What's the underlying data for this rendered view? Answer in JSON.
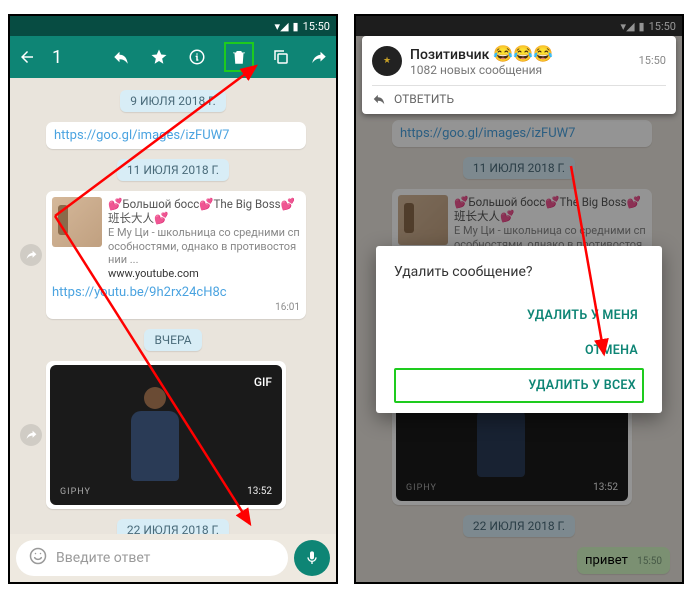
{
  "status": {
    "time": "15:50"
  },
  "select_header": {
    "count": "1"
  },
  "dates": {
    "d1": "9 ИЮЛЯ 2018 Г.",
    "d2": "11 ИЮЛЯ 2018 Г.",
    "d3": "ВЧЕРА",
    "d4": "22 ИЮЛЯ 2018 Г."
  },
  "msgs": {
    "link1": "https://goo.gl/images/izFUW7",
    "preview_title": "💕Большой босс💕The Big Boss💕班长大人💕",
    "preview_desc": "Е Му Ци - школьница со средними способностями, однако в противостоянии ...",
    "preview_site": "www.youtube.com",
    "link2": "https://youtu.be/9h2rx24cH8c",
    "link2_time": "16:01",
    "gif_label": "GIF",
    "gif_brand": "GIPHY",
    "gif_time": "13:52",
    "hello": "привет",
    "hello_time": "15:50"
  },
  "composer": {
    "placeholder": "Введите ответ"
  },
  "notif": {
    "title": "Позитивчик",
    "emoji": "😂😂😂",
    "sub": "1082 новых сообщения",
    "time": "15:50",
    "reply": "ОТВЕТИТЬ"
  },
  "dialog": {
    "title": "Удалить сообщение?",
    "opt1": "УДАЛИТЬ У МЕНЯ",
    "opt2": "ОТМЕНА",
    "opt3": "УДАЛИТЬ У ВСЕХ"
  }
}
